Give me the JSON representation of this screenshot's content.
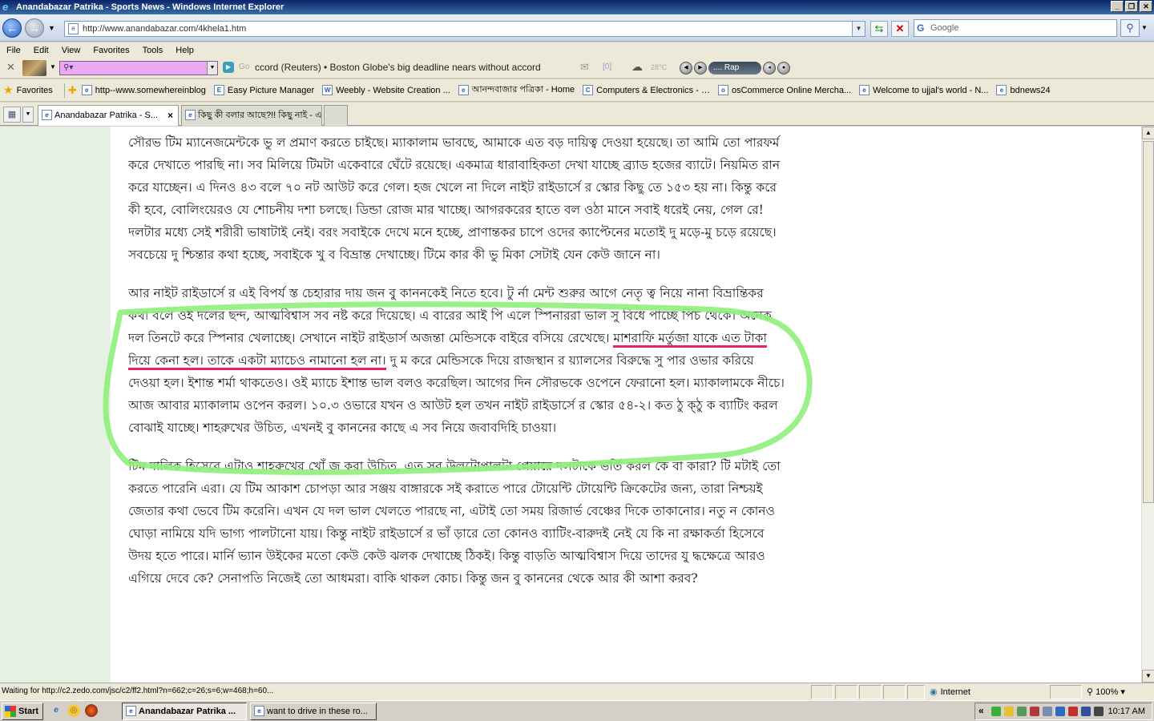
{
  "window": {
    "title": "Anandabazar Patrika - Sports News - Windows Internet Explorer"
  },
  "address": {
    "url": "http://www.anandabazar.com/4khela1.htm",
    "search_placeholder": "Google"
  },
  "menu": [
    "File",
    "Edit",
    "View",
    "Favorites",
    "Tools",
    "Help"
  ],
  "toolbar": {
    "go_label": "Go",
    "ticker": "ccord (Reuters)  • Boston Globe's big deadline nears without accord",
    "mail_count": "[0]",
    "temperature": "28°C",
    "player_label": ".... Rap"
  },
  "favorites": {
    "label": "Favorites",
    "items": [
      {
        "label": "http--www.somewhereinblog",
        "icon": "e"
      },
      {
        "label": "Easy Picture Manager",
        "icon": "E"
      },
      {
        "label": "Weebly - Website Creation ...",
        "icon": "W"
      },
      {
        "label": "আনন্দবাজার পত্রিকা - Home",
        "icon": "e"
      },
      {
        "label": "Computers & Electronics - …",
        "icon": "C"
      },
      {
        "label": "osCommerce Online Mercha...",
        "icon": "o"
      },
      {
        "label": "Welcome to ujjal's world - N...",
        "icon": "e"
      },
      {
        "label": "bdnews24",
        "icon": "e"
      }
    ]
  },
  "tabs": {
    "active": "Anandabazar Patrika - S...",
    "second": "কিছু কী বলার আছে?!! কিছু নাই - এক বাগা..."
  },
  "article": {
    "p1": "সৌরভ টিম ম্যানেজমেন্টকে ভু ল প্রমাণ করতে চাইছে। ম্যাকালাম ভাবছে, আমাকে এত বড় দায়িত্ব দেওয়া হয়েছে। তা আমি তো পারফর্ম করে দেখাতে পারছি না। সব মিলিয়ে টিমটা একেবারে ঘেঁটে রয়েছে। একমাত্র ধারাবাহিকতা দেখা যাচ্ছে ব্র্যাড হজের ব্যাটে। নিয়মিত রান করে যাচ্ছেন। এ দিনও ৪৩ বলে ৭০ নট আউট করে গেল। হজ খেলে না দিলে নাইট রাইডার্সে র স্কোর কিছু তে ১৫৩ হয় না। কিন্তু করে কী হবে, বোলিংয়েরও যে শোচনীয় দশা চলছে। ডিন্ডা রোজ মার খাচ্ছে। আগরকরের হাতে বল ওঠা মানে সবাই ধরেই নেয়, গেল রে! দলটার মধ্যে সেই শরীরী ভাষাটাই নেই। বরং সবাইকে দেখে মনে হচ্ছে, প্রাণান্তকর চাপে ওদের ক্যাপ্টেনের মতোই দু মড়ে-মু চড়ে রয়েছে। সবচেয়ে দু শ্চিন্তার কথা হচ্ছে, সবাইকে খু ব বিভ্রান্ত দেখাচ্ছে। টিমে কার কী ভু মিকা সেটাই যেন কেউ জানে না।",
    "p2_a": "আর নাইট রাইডার্সে র এই বিপর্য স্ত চেহারার দায় জন বু কাননকেই নিতে হবে। টু র্না মেন্ট শুরুর আগে নেতৃ ত্ব নিয়ে নানা বিভ্রান্তিকর কথা বলে ওই দলের ছন্দ, আত্মবিশ্বাস সব নষ্ট করে দিয়েছে। এ বারের আই পি এলে স্পিনাররা ভাল সু বিধে পাচ্ছে পিচ থেকে। অনেক দল তিনটে করে স্পিনার খেলাচ্ছে। সেখানে নাইট রাইডার্স অজন্তা মেন্ডিসকে বাইরে বসিয়ে রেখেছে। ",
    "p2_underlined": "মাশরাফি মর্তুজা যাকে এত টাকা দিয়ে কেনা হল। তাকে একটা ম্যাচেও নামানো হল না।",
    "p2_b": " দু ম করে মেন্ডিসকে দিয়ে রাজস্থান র য়্যালসের বিরুদ্ধে সু পার ওভার করিয়ে দেওয়া হল। ইশান্ত শর্মা থাকতেও। ওই ম্যাচে ইশান্ত ভাল বলও করেছিল। আগের দিন সৌরভকে ওপেনে ফেরানো হল। ম্যাকালামকে নীচে। আজ আবার ম্যাকালাম ওপেন করল। ১০.৩ ওভারে যখন ও আউট হল তখন নাইট রাইডার্সে র স্কোর ৫৪-২। কত ঠু ক্ঠু ক ব্যাটিং করল বোঝাই যাচ্ছে। শাহরুখের উচিত, এখনই বু কাননের কাছে এ সব নিয়ে জবাবদিহি চাওয়া।",
    "p3": "টিম মালিক হিসেবে এটাও শাহরুখের খোঁ জ করা উচিত, এত সব উলটোপালটা প্লেয়ারে দলটাকে ভর্তি করল কে বা কারা? টি মটাই তো করতে পারেনি এরা। যে টিম আকাশ চোপড়া আর সঞ্জয় বাঙ্গারকে সই করাতে পারে টোয়েন্টি টোয়েন্টি ক্রিকেটের জন্য, তারা নিশ্চয়ই জেতার কথা ভেবে টিম করেনি। এখন যে দল ভাল খেলতে পারছে না, এটাই তো সময় রিজার্ভ বেঞ্চের দিকে তাকানোর। নতু ন কোনও ঘোড়া নামিয়ে যদি ভাগ্য পালটানো যায়। কিন্তু নাইট রাইডার্সে র ভাঁ ড়ারে তো কোনও ব্যাটিং-বারুদই নেই যে কি না রক্ষাকর্তা হিসেবে উদয় হতে পারে। মার্নি ভ্যান উইকের মতো কেউ কেউ ঝলক দেখাচ্ছে ঠিকই। কিন্তু বাড়তি আত্মবিশ্বাস দিয়ে তাদের যু দ্ধক্ষেত্রে আরও এগিয়ে দেবে কে? সেনাপতি নিজেই তো আধমরা। বাকি থাকল কোচ। কিন্তু জন বু কাননের থেকে আর কী আশা করব?"
  },
  "status": {
    "text": "Waiting for http://c2.zedo.com/jsc/c2/ff2.html?n=662;c=26;s=6;w=468;h=60...",
    "zone": "Internet",
    "zoom": "100%"
  },
  "taskbar": {
    "start": "Start",
    "task1": "Anandabazar Patrika ...",
    "task2": "want to drive in these ro...",
    "clock": "10:17 AM"
  },
  "colors": {
    "highlight_loop": "#8ef07a",
    "underline": "#e8245a",
    "sidebar_bg": "#e6f1e4"
  }
}
